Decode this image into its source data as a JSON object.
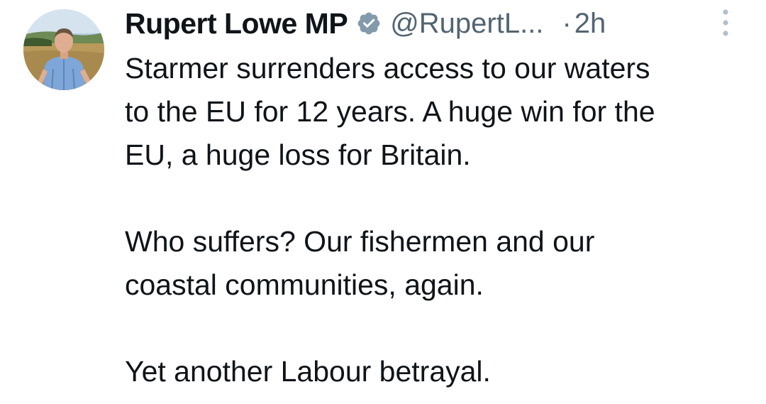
{
  "tweet": {
    "author": {
      "display_name": "Rupert Lowe MP",
      "handle": "@RupertL...",
      "verified_icon": "verified-badge-icon",
      "avatar_icon": "avatar"
    },
    "separator": "·",
    "timestamp": "2h",
    "more_icon": "more-options-icon",
    "paragraphs": [
      {
        "lines": [
          "Starmer surrenders access to our waters",
          "to the EU for 12 years. A huge win for the",
          "EU, a huge loss for Britain."
        ]
      },
      {
        "lines": [
          "Who suffers? Our fishermen and our",
          "coastal communities, again."
        ]
      },
      {
        "lines": [
          "Yet another Labour betrayal."
        ]
      }
    ]
  },
  "colors": {
    "text_primary": "#0f1419",
    "text_secondary": "#536471",
    "verified_badge": "#829aab",
    "background": "#ffffff"
  }
}
